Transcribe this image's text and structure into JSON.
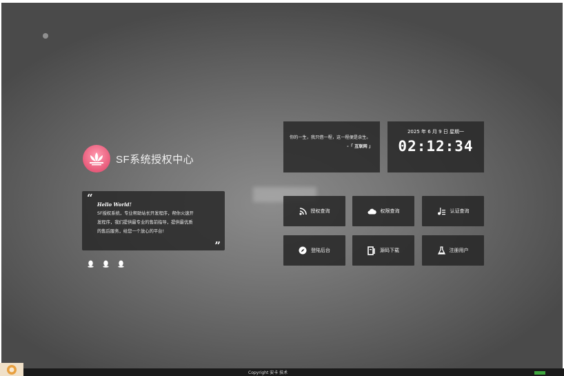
{
  "brand": {
    "title": "SF系统授权中心"
  },
  "intro": {
    "hello": "Hello World!",
    "lines": [
      "SF授权系统，专业帮助站长开发程序，帮你火速开",
      "发程序，我们提供最专业的售前指导，提供最优质",
      "的售后服务，给您一个放心的平台!"
    ]
  },
  "poem": {
    "text": "你的一生，我只借一程，这一程便是余生。",
    "source": "-「 互联网 」"
  },
  "clock": {
    "date": "2025 年 6 月 9 日 星期一",
    "time": "02:12:34"
  },
  "tiles": [
    {
      "label": "授权查询",
      "icon": "rss-icon"
    },
    {
      "label": "权限查询",
      "icon": "cloud-icon"
    },
    {
      "label": "认证查询",
      "icon": "music-list-icon"
    },
    {
      "label": "登陆后台",
      "icon": "compass-icon"
    },
    {
      "label": "源码下载",
      "icon": "download-book-icon"
    },
    {
      "label": "注册用户",
      "icon": "flask-icon"
    }
  ],
  "footer": {
    "copyright": "Copyright 安卡 技术"
  },
  "colors": {
    "card_bg": "#282828",
    "logo": "#e85a7a"
  }
}
